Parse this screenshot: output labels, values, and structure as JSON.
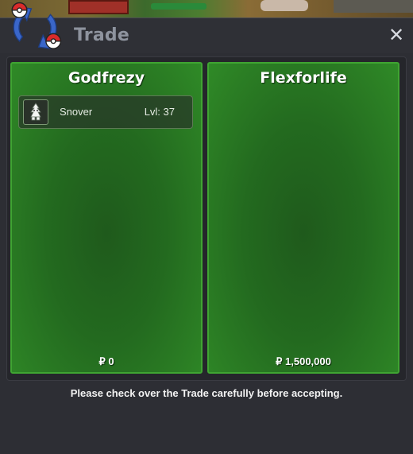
{
  "window": {
    "title": "Trade",
    "close_label": "✕"
  },
  "colors": {
    "panel_green": "#2b7e24",
    "panel_border": "#3fa432",
    "window_bg": "#2d2e34"
  },
  "left_panel": {
    "player_name": "Godfrezy",
    "items": [
      {
        "icon": "snover-sprite-icon",
        "name": "Snover",
        "level": "Lvl: 37"
      }
    ],
    "money": "₽ 0"
  },
  "right_panel": {
    "player_name": "Flexforlife",
    "items": [],
    "money": "₽ 1,500,000"
  },
  "notice": "Please check over the Trade carefully before accepting."
}
